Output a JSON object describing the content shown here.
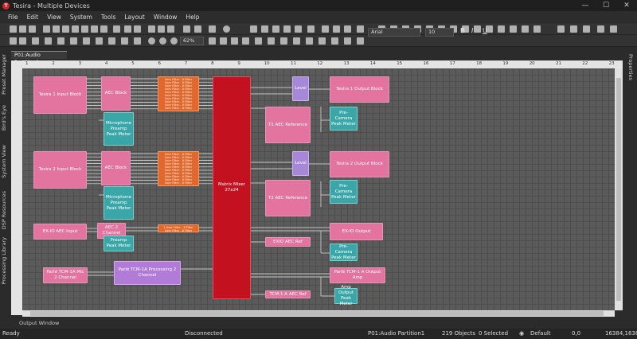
{
  "window": {
    "title": "Tesira - Multiple Devices",
    "logo": "T",
    "minimize": "—",
    "maximize": "☐",
    "close": "✕"
  },
  "menu": [
    "File",
    "Edit",
    "View",
    "System",
    "Tools",
    "Layout",
    "Window",
    "Help"
  ],
  "toolbar2": {
    "zoom_value": "62%"
  },
  "toolbar3": {
    "font_name": "Arial",
    "font_size": "10",
    "bold": "B",
    "italic": "I",
    "underline": "U"
  },
  "left_tabs": [
    "Preset Manager",
    "Bird's Eye",
    "System View",
    "DSP Resources",
    "Processing Library"
  ],
  "right_tab": "Properties",
  "doc_tab": "P01:Audio Partition1",
  "ruler": {
    "cols": [
      "1",
      "2",
      "3",
      "4",
      "5",
      "6",
      "7",
      "8",
      "9",
      "10",
      "11",
      "12",
      "13",
      "14",
      "15",
      "16",
      "17",
      "18",
      "19",
      "20",
      "21",
      "22",
      "23"
    ]
  },
  "output_window": "Output Window",
  "status": {
    "ready": "Ready",
    "connection": "Disconnected",
    "partition": "P01:Audio Partition1",
    "objects": "219 Objects",
    "selected": "0 Selected",
    "view": "Default",
    "coord_a": "0,0",
    "coord_b": "16384,16384"
  },
  "blocks": {
    "tesira1_input": "Tesira 1 Input Block",
    "aec1": "AEC Block",
    "mic_peak1": "Microphone Preamp Peak Meter",
    "uf_rows1": [
      "User Filter - 6 Filter",
      "User Filter - 6 Filter",
      "User Filter - 6 Filter",
      "User Filter - 6 Filter",
      "User Filter - 6 Filter",
      "User Filter - 6 Filter",
      "User Filter - 6 Filter",
      "User Filter - 6 Filter",
      "User Filter - 6 Filter",
      "User Filter - 6 Filter"
    ],
    "level1": "Level",
    "tesira1_output": "Tesira 1 Output Block",
    "t1_aec_ref": "T1 AEC Reference",
    "pre_camera1": "Pre-Camera Peak Meter",
    "tesira2_input": "Tesira 2 Input Block",
    "aec2": "AEC Block",
    "mic_peak2": "Microphone Preamp Peak Meter",
    "uf_rows2": [
      "User Filter - 6 Filter",
      "User Filter - 6 Filter",
      "User Filter - 6 Filter",
      "User Filter - 6 Filter",
      "User Filter - 6 Filter",
      "User Filter - 6 Filter",
      "User Filter - 6 Filter",
      "User Filter - 6 Filter",
      "User Filter - 6 Filter",
      "User Filter - 6 Filter"
    ],
    "level2": "Level",
    "tesira2_output": "Tesira 2 Output Block",
    "t2_aec_ref": "T2 AEC Reference",
    "pre_camera2": "Pre-Camera Peak Meter",
    "matrix": "Matrix Mixer 27x24",
    "ex_io_aec_input": "EX-IO AEC Input",
    "aec_2ch": "AEC 2 Channel",
    "uf_rows3": [
      "1 User Filter - 6 Filter",
      "User Filter - 6 Filter"
    ],
    "preamp_peak": "Preamp Peak Meter",
    "exio_aec_ref": "EXIO AEC Ref",
    "ex_io_output": "EX-IO Output",
    "pre_camera3": "Pre-Camera Peak Meter",
    "parle_mic": "Parlé TCM-1A Mic 2 Channel",
    "parle_proc": "Parlé TCM-1A Processing 2 Channel",
    "tcm_aec_ref": "TCM-1 A AEC Ref",
    "parle_output_amp": "Parlé TCM-1 A Output Amp",
    "amp_output_peak": "Amp Output Peak Meter"
  },
  "colors": {
    "block_pink": "#e2749f",
    "block_teal": "#3aa6a8",
    "block_lavender": "#a687d8",
    "filter_orange": "#e2672c",
    "matrix_red": "#c4111f",
    "canvas_gray": "#5a5a5a"
  }
}
